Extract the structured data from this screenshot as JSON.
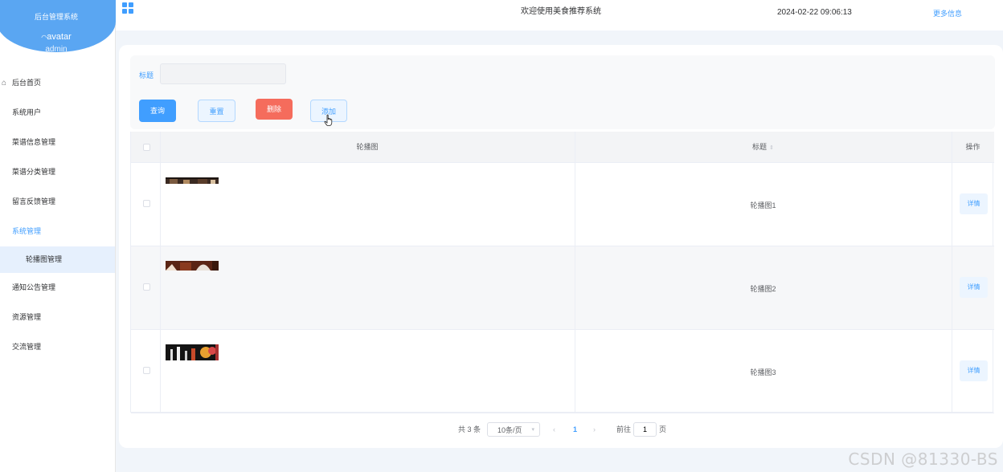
{
  "sidebar": {
    "system_name": "后台管理系统",
    "avatar_alt": "avatar",
    "username": "admin",
    "items": [
      {
        "label": "后台首页"
      },
      {
        "label": "系统用户"
      },
      {
        "label": "菜谱信息管理"
      },
      {
        "label": "菜谱分类管理"
      },
      {
        "label": "留言反馈管理"
      },
      {
        "label": "系统管理"
      },
      {
        "label": "轮播图管理"
      },
      {
        "label": "通知公告管理"
      },
      {
        "label": "资源管理"
      },
      {
        "label": "交流管理"
      }
    ]
  },
  "header": {
    "welcome": "欢迎使用美食推荐系统",
    "datetime": "2024-02-22 09:06:13",
    "more": "更多信息"
  },
  "search": {
    "title_label": "标题",
    "title_value": ""
  },
  "toolbar": {
    "query": "查询",
    "reset": "重置",
    "delete": "删除",
    "add": "添加"
  },
  "table": {
    "columns": {
      "image": "轮播图",
      "title": "标题",
      "actions": "操作"
    },
    "rows": [
      {
        "title": "轮播图1",
        "action": "详情"
      },
      {
        "title": "轮播图2",
        "action": "详情"
      },
      {
        "title": "轮播图3",
        "action": "详情"
      }
    ]
  },
  "pagination": {
    "total": "共 3 条",
    "page_size": "10条/页",
    "prev": "‹",
    "current": "1",
    "next": "›",
    "goto": "前往",
    "jump_value": "1",
    "page_suffix": "页"
  },
  "watermark": "CSDN @81330-BS",
  "colors": {
    "primary": "#409eff",
    "danger": "#f56c5c",
    "sidebar_brand": "#5aa6f2",
    "page_bg": "#f1f5fa"
  }
}
